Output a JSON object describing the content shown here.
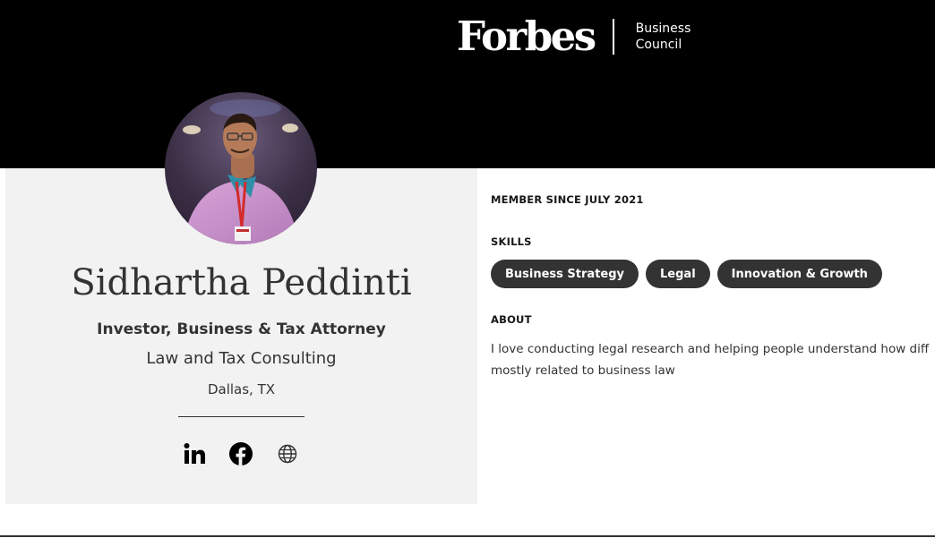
{
  "header": {
    "logo_text": "Forbes",
    "council_line1": "Business",
    "council_line2": "Council"
  },
  "profile": {
    "name": "Sidhartha Peddinti",
    "title": "Investor, Business & Tax Attorney",
    "company": "Law and Tax Consulting",
    "location": "Dallas, TX",
    "social_icons": [
      "linkedin-icon",
      "facebook-icon",
      "globe-icon"
    ]
  },
  "details": {
    "member_since": "MEMBER SINCE JULY 2021",
    "skills_label": "SKILLS",
    "skills": [
      "Business Strategy",
      "Legal",
      "Innovation & Growth"
    ],
    "about_label": "ABOUT",
    "about_lines": [
      "I love conducting legal research and helping people understand how diff",
      "mostly related to business law"
    ]
  },
  "colors": {
    "header_bg": "#000000",
    "card_bg": "#f2f2f2",
    "chip_bg": "#333333",
    "text": "#333333"
  }
}
